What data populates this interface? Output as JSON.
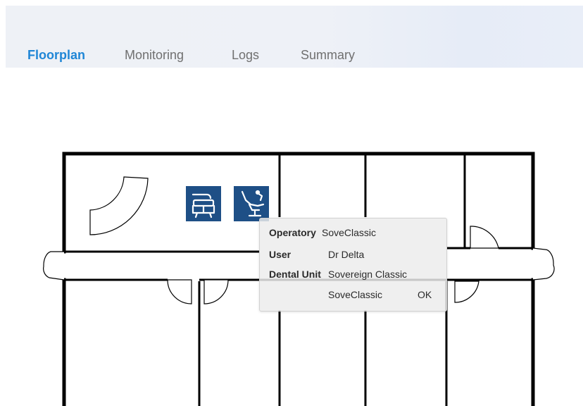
{
  "tabs": [
    {
      "label": "Floorplan",
      "active": true
    },
    {
      "label": "Monitoring",
      "active": false
    },
    {
      "label": "Logs",
      "active": false
    },
    {
      "label": "Summary",
      "active": false
    }
  ],
  "colors": {
    "active_tab": "#1f86d6",
    "inactive_tab": "#707070",
    "chair_icon_bg": "#1e4f86",
    "wall": "#000000"
  },
  "floorplan": {
    "chairs": [
      {
        "icon": "dental-chair-front-icon"
      },
      {
        "icon": "dental-chair-side-icon"
      }
    ]
  },
  "popup": {
    "operatory_label": "Operatory",
    "operatory_value": "SoveClassic",
    "user_label": "User",
    "user_value": "Dr Delta",
    "unit_label": "Dental Unit",
    "unit_value": "Sovereign Classic",
    "action_value": "SoveClassic",
    "ok_label": "OK"
  }
}
